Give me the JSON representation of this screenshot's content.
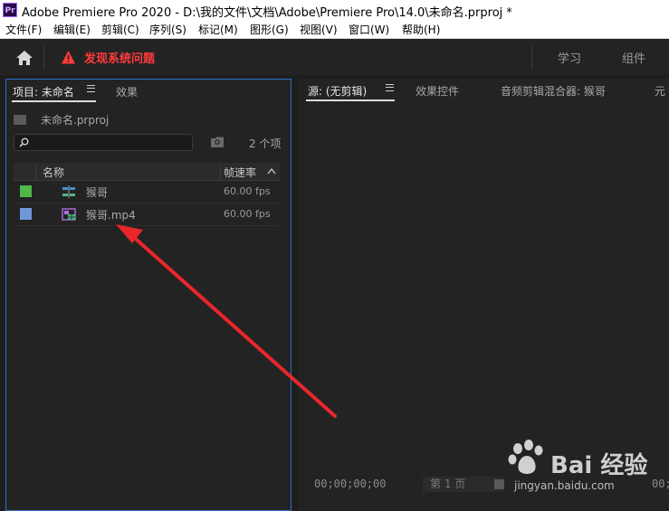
{
  "window": {
    "title": "Adobe Premiere Pro 2020 - D:\\我的文件\\文档\\Adobe\\Premiere Pro\\14.0\\未命名.prproj *",
    "app_icon": "Pr"
  },
  "menu": [
    "文件(F)",
    "编辑(E)",
    "剪辑(C)",
    "序列(S)",
    "标记(M)",
    "图形(G)",
    "视图(V)",
    "窗口(W)",
    "帮助(H)"
  ],
  "header": {
    "warning_text": "发现系统问题",
    "workspaces": [
      "学习",
      "组件"
    ],
    "warning_color": "#ff3b3b"
  },
  "project_panel": {
    "tabs": [
      "项目: 未命名",
      "效果"
    ],
    "project_file": "未命名.prproj",
    "search": {
      "value": "",
      "placeholder": ""
    },
    "item_count": "2 个项",
    "columns": {
      "name": "名称",
      "frame_rate": "帧速率"
    },
    "items": [
      {
        "name": "猴哥",
        "fps": "60.00 fps",
        "label_color": "#4fb848",
        "icon": "sequence-icon"
      },
      {
        "name": "猴哥.mp4",
        "fps": "60.00 fps",
        "label_color": "#6f97d9",
        "icon": "video-clip-icon"
      }
    ]
  },
  "source_panel": {
    "tabs": [
      "源: (无剪辑)",
      "效果控件",
      "音频剪辑混合器: 猴哥",
      "元"
    ],
    "timecode_in": "00;00;00;00",
    "page_label": "第 1 页",
    "timecode_out": "00;"
  },
  "watermark": {
    "brand": "Bai 经验",
    "url": "jingyan.baidu.com"
  },
  "accent_color": "#2f6ec7"
}
